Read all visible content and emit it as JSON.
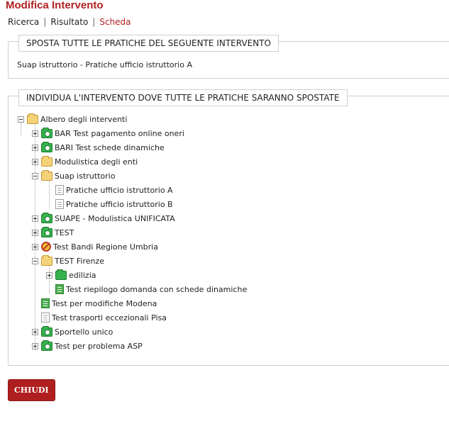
{
  "page_title": "Modifica Intervento",
  "breadcrumb": {
    "items": [
      "Ricerca",
      "Risultato",
      "Scheda"
    ],
    "separator": "|"
  },
  "section_move": {
    "legend": "SPOSTA TUTTE LE PRATICHE DEL SEGUENTE INTERVENTO",
    "value": "Suap istruttorio - Pratiche ufficio istruttorio A"
  },
  "section_target": {
    "legend": "INDIVIDUA L'INTERVENTO DOVE TUTTE LE PRATICHE SARANNO SPOSTATE"
  },
  "tree": {
    "nodes": [
      {
        "label": "Albero degli interventi",
        "icon": "folder-open-icon"
      },
      {
        "label": "BAR Test pagamento online oneri",
        "icon": "green-folder-icon"
      },
      {
        "label": "BARI Test schede dinamiche",
        "icon": "green-folder-icon"
      },
      {
        "label": "Modulistica degli enti",
        "icon": "folder-icon"
      },
      {
        "label": "Suap istruttorio",
        "icon": "folder-open-icon"
      },
      {
        "label": "Pratiche ufficio istruttorio A",
        "icon": "document-icon"
      },
      {
        "label": "Pratiche ufficio istruttorio B",
        "icon": "document-icon"
      },
      {
        "label": "SUAPE - Modulistica UNIFICATA",
        "icon": "green-folder-icon"
      },
      {
        "label": "TEST",
        "icon": "green-folder-icon"
      },
      {
        "label": "Test Bandi Regione Umbria",
        "icon": "forbidden-icon"
      },
      {
        "label": "TEST Firenze",
        "icon": "folder-open-icon"
      },
      {
        "label": "edilizia",
        "icon": "green-folder-icon"
      },
      {
        "label": "Test riepilogo domanda con schede dinamiche",
        "icon": "green-document-icon"
      },
      {
        "label": "Test per modifiche Modena",
        "icon": "green-folder-icon"
      },
      {
        "label": "Test trasporti eccezionali Pisa",
        "icon": "document-icon"
      },
      {
        "label": "Sportello unico",
        "icon": "green-folder-icon"
      },
      {
        "label": "Test per problema ASP",
        "icon": "green-folder-icon"
      }
    ]
  },
  "close_button": "CHIUDI",
  "colors": {
    "accent": "#b01f1f"
  }
}
